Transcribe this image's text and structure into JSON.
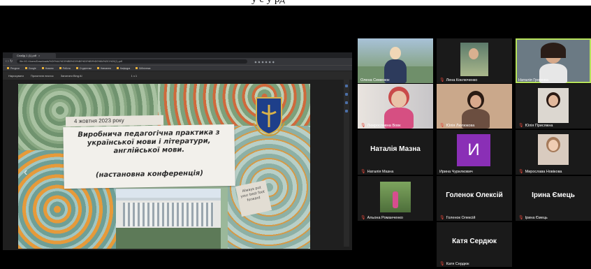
{
  "screen_share": {
    "browser_tab": "Слайд 1 (1).pdf",
    "tab_close": "×",
    "nav_icons": "‹ › ↻",
    "url": "file:///C:/Users/Downloads/%D0%A1%D0%BB%D0%B0%D0%B9%D0%B4%201%20(1).pdf",
    "bookmarks": [
      "Ресурси",
      "Google",
      "Новини",
      "Робота",
      "Студентам",
      "Навчання",
      "Кафедра",
      "Бібліотека"
    ],
    "viewer_tools": [
      "Нарисувати",
      "Прочитати вголос",
      "Запитати Bing AI"
    ],
    "page_indicator": "1 з 1",
    "slide": {
      "date": "4 жовтня  2023 року",
      "title": "Виробнича педагогічна практика з української мови і літератури, англійської мови.",
      "subtitle": "(настановна  конференція)",
      "note": "Always put your best foot forward",
      "prev_arrow": "‹"
    }
  },
  "participants": [
    {
      "name": "Олена Семенюк",
      "type": "video"
    },
    {
      "name": "Лена  Коключенко",
      "type": "video"
    },
    {
      "name": "Наталія Громова",
      "type": "video",
      "active": true
    },
    {
      "name": "Люкрославна Вовк",
      "type": "video"
    },
    {
      "name": "Юлія Люлюкова",
      "type": "video"
    },
    {
      "name": "Юлія Присяжна",
      "type": "video"
    },
    {
      "name": "Наталія Мазна",
      "type": "name",
      "display": "Наталія Мазна"
    },
    {
      "name": "Ирина Чурилкович",
      "type": "avatar",
      "initial": "И"
    },
    {
      "name": "Мирослава Новікова",
      "type": "video"
    },
    {
      "name": "Альона Романченко",
      "type": "video"
    },
    {
      "name": "Голенок Олексій",
      "type": "name",
      "display": "Голенок Олексій"
    },
    {
      "name": "Ірина Ємець",
      "type": "name",
      "display": "Ірина Ємець"
    },
    {
      "name": "Катя Сердюк",
      "type": "name",
      "display": "Катя Сердюк"
    }
  ],
  "caption_fragment": "ӯ     ӗ          ӯ     рд",
  "colors": {
    "active_border": "#b6e25a",
    "avatar": "#8a2fb6",
    "muted_mic": "#e0473a"
  }
}
